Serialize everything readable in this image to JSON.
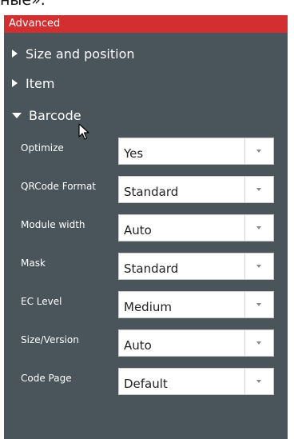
{
  "top_partial_text": "ные».",
  "panel": {
    "title": "Advanced",
    "sections": [
      {
        "label": "Size and position",
        "expanded": false
      },
      {
        "label": "Item",
        "expanded": false
      },
      {
        "label": "Barcode",
        "expanded": true
      }
    ]
  },
  "barcode_fields": [
    {
      "label": "Optimize",
      "value": "Yes"
    },
    {
      "label": "QRCode Format",
      "value": "Standard"
    },
    {
      "label": "Module width",
      "value": "Auto"
    },
    {
      "label": "Mask",
      "value": "Standard"
    },
    {
      "label": "EC Level",
      "value": "Medium"
    },
    {
      "label": "Size/Version",
      "value": "Auto"
    },
    {
      "label": "Code Page",
      "value": "Default"
    }
  ],
  "colors": {
    "header_red": "#d42f30",
    "panel_bg": "#4a545b",
    "text_white": "#ffffff"
  },
  "icons": {
    "collapsed": "triangle-right-icon",
    "expanded": "triangle-down-icon",
    "dropdown": "chevron-down-icon",
    "pointer": "mouse-cursor-icon"
  }
}
